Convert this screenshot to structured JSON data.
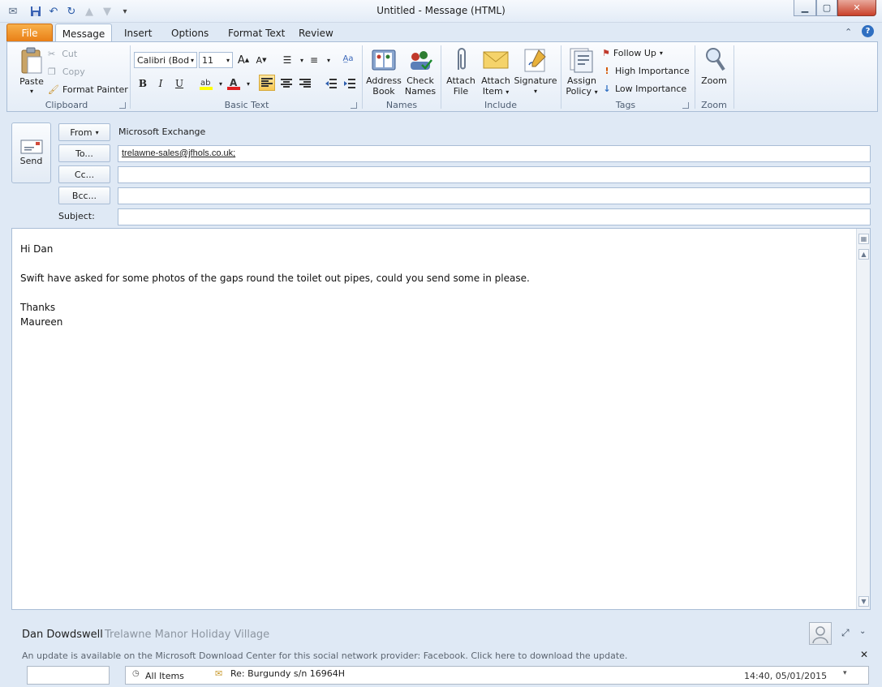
{
  "window": {
    "title": "Untitled  -  Message (HTML)"
  },
  "tabs": [
    {
      "label": "File"
    },
    {
      "label": "Message"
    },
    {
      "label": "Insert"
    },
    {
      "label": "Options"
    },
    {
      "label": "Format Text"
    },
    {
      "label": "Review"
    }
  ],
  "ribbon": {
    "clipboard": {
      "paste": "Paste",
      "cut": "Cut",
      "copy": "Copy",
      "format_painter": "Format Painter",
      "group": "Clipboard"
    },
    "basic_text": {
      "font": "Calibri (Bod",
      "size": "11",
      "group": "Basic Text"
    },
    "names": {
      "address_book_1": "Address",
      "address_book_2": "Book",
      "check_names_1": "Check",
      "check_names_2": "Names",
      "group": "Names"
    },
    "include": {
      "attach_file_1": "Attach",
      "attach_file_2": "File",
      "attach_item_1": "Attach",
      "attach_item_2": "Item",
      "signature": "Signature",
      "group": "Include"
    },
    "tags": {
      "assign_policy_1": "Assign",
      "assign_policy_2": "Policy",
      "follow_up": "Follow Up",
      "high_importance": "High Importance",
      "low_importance": "Low Importance",
      "group": "Tags"
    },
    "zoom": {
      "zoom": "Zoom",
      "group": "Zoom"
    }
  },
  "compose": {
    "send_label": "Send",
    "from_label": "From",
    "from_value": "Microsoft Exchange",
    "to_label": "To...",
    "to_value": "trelawne-sales@jfhols.co.uk;",
    "cc_label": "Cc...",
    "cc_value": "",
    "bcc_label": "Bcc...",
    "bcc_value": "",
    "subject_label": "Subject:",
    "subject_value": ""
  },
  "body": {
    "lines": [
      "Hi Dan",
      "Swift have asked for some photos of the gaps round the toilet out pipes, could you send some in please.",
      "Thanks",
      "Maureen"
    ]
  },
  "people_pane": {
    "contact_name": "Dan Dowdswell",
    "contact_company": "Trelawne Manor Holiday Village",
    "update_message": "An update is available on the Microsoft Download Center for this social network provider: Facebook. Click here to download the update.",
    "feed_folder": "All Items",
    "feed_subject": "Re: Burgundy s/n 16964H",
    "feed_time": "14:40, 05/01/2015"
  },
  "colors": {
    "file_tab": "#e97f16",
    "ribbon_border": "#a9bdd6",
    "highlight_button": "#f8c954"
  }
}
